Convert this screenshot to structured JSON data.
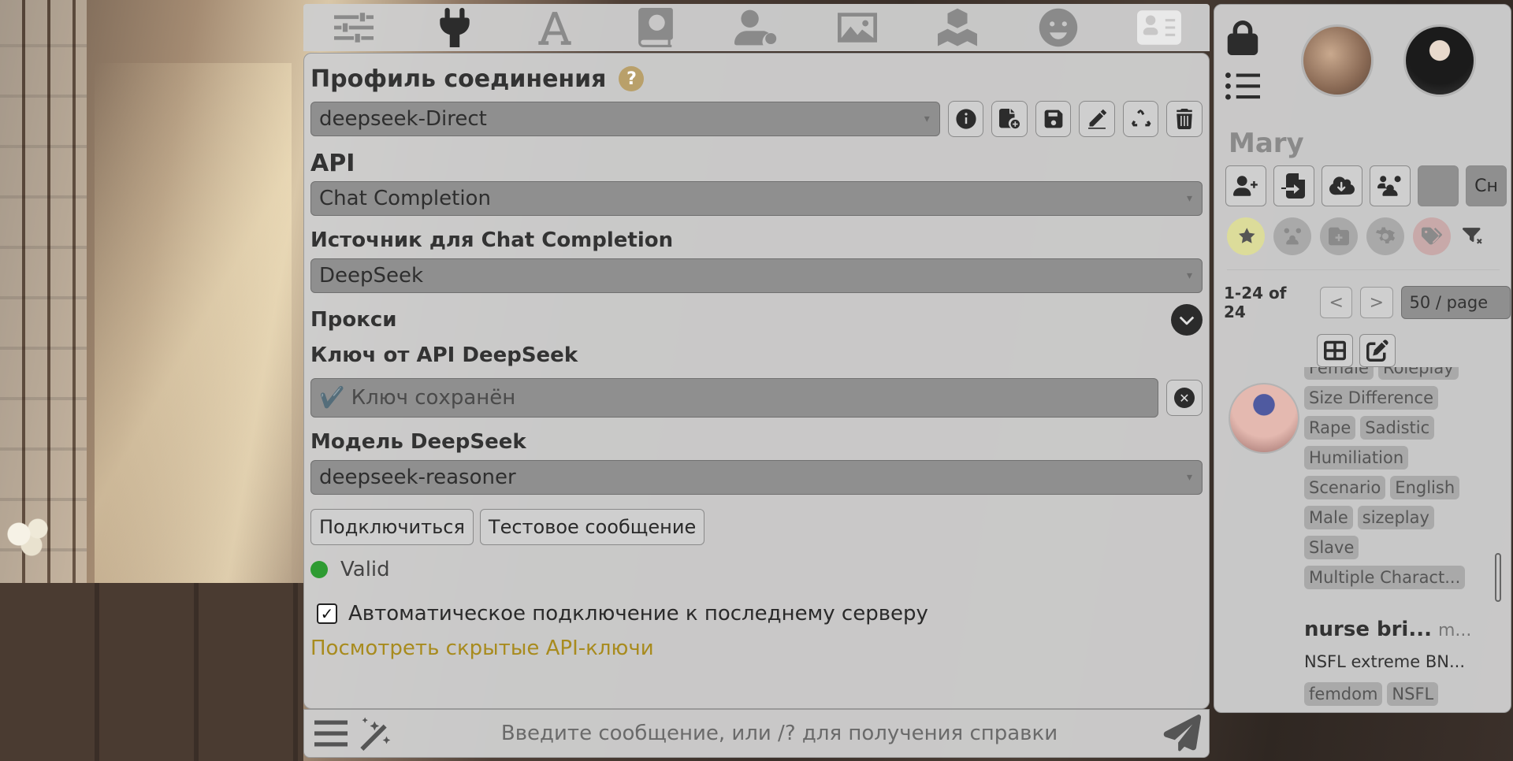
{
  "topnav": {
    "icons": [
      "sliders-icon",
      "plug-icon",
      "font-icon",
      "book-globe-icon",
      "user-gear-icon",
      "image-icon",
      "cubes-icon",
      "smile-icon",
      "id-card-icon"
    ]
  },
  "connection": {
    "title": "Профиль соединения",
    "help": "?",
    "profile": "deepseek-Direct"
  },
  "api": {
    "label": "API",
    "value": "Chat Completion"
  },
  "source": {
    "label": "Источник для Chat Completion",
    "value": "DeepSeek"
  },
  "proxy": {
    "label": "Прокси"
  },
  "api_key": {
    "label": "Ключ от API DeepSeek",
    "value": "✔️ Ключ сохранён"
  },
  "model": {
    "label": "Модель DeepSeek",
    "value": "deepseek-reasoner"
  },
  "actions": {
    "connect": "Подключиться",
    "test": "Тестовое сообщение"
  },
  "status": {
    "text": "Valid",
    "color": "#2e9b32"
  },
  "auto_connect": {
    "label": "Автоматическое подключение к последнему серверу",
    "checked": true
  },
  "hidden_keys_link": "Посмотреть скрытые API-ключи",
  "chat": {
    "placeholder": "Введите сообщение, или /? для получения справки"
  },
  "right_panel": {
    "name": "Mary",
    "ch_button": "Cн",
    "pager_count": "1-24 of 24",
    "prev": "<",
    "next": ">",
    "per_page": "50 / page",
    "char1_tags": [
      "Female",
      "Roleplay",
      "Size Difference",
      "Rape",
      "Sadistic",
      "Humiliation",
      "Scenario",
      "English",
      "Male",
      "sizeplay",
      "Slave",
      "Multiple Charact..."
    ],
    "char2_name": "nurse bri...",
    "char2_creator": "m...",
    "char2_desc": "NSFL extreme BN...",
    "char2_tags": [
      "femdom",
      "NSFL"
    ]
  }
}
